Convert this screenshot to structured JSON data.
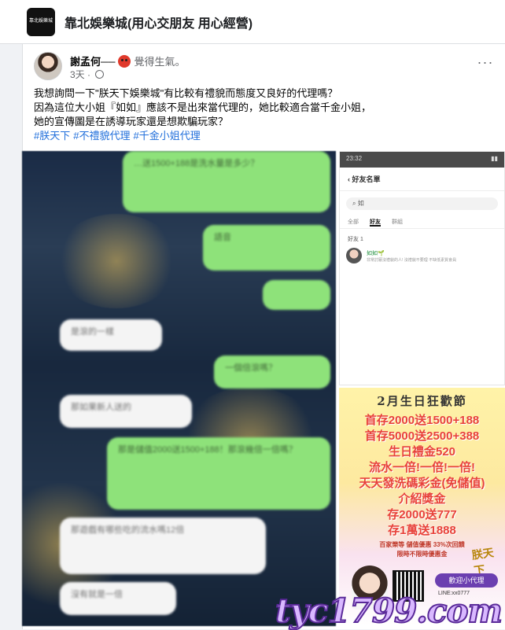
{
  "page": {
    "logo_text": "靠北娛樂城",
    "name": "靠北娛樂城(用心交朋友 用心經營)"
  },
  "post": {
    "author": "謝孟何",
    "author_suffix": "──",
    "feeling": "覺得生氣。",
    "time": "3天",
    "text_lines": [
      "我想詢問一下\"朕天下娛樂城\"有比較有禮貌而態度又良好的代理嗎？",
      "因為這位大小姐『如如』應該不是出來當代理的，她比較適合當千金小姐，",
      "她的宣傳圖是在誘導玩家還是想欺騙玩家？"
    ],
    "hashtags": [
      "#朕天下",
      "#不禮貌代理",
      "#千金小姐代理"
    ]
  },
  "chat_image": {
    "bubbles": [
      "…送1500+188是洗水量是多少？",
      "語音",
      "",
      "是滾的一樣",
      "一個倍滾嗎？",
      "那如果新人送的",
      "那是儲值2000送1500+188！那滾幾倍一倍嗎？",
      "那遊戲有哪些吃的流水嗎12倍",
      "沒有就是一倍"
    ]
  },
  "friends_image": {
    "status_time": "23:32",
    "title": "好友名單",
    "search_value": "如",
    "tabs": [
      "全部",
      "好友",
      "群組"
    ],
    "active_tab": "好友",
    "section": "好友 1",
    "friend_name": "如如🌱",
    "friend_status": "非常討厭沒禮貌的人! 沒禮貌不要理 不缺低素質會員"
  },
  "promo_image": {
    "title": "2月生日狂歡節",
    "lines": [
      "首存2000送1500+188",
      "首存5000送2500+388",
      "生日禮金520",
      "流水一倍!一倍!一倍!",
      "天天發洗碼彩金(免儲值)",
      "介紹獎金",
      "存2000送777",
      "存1萬送1888"
    ],
    "small_lines": [
      "百家樂等 儲值優惠 33%次回饋",
      "限時不限時優惠金"
    ],
    "add_button": "歡迎小代理",
    "line_id": "LINE:xx0777",
    "logo": "朕天下"
  },
  "watermark": "tyc1799.com"
}
